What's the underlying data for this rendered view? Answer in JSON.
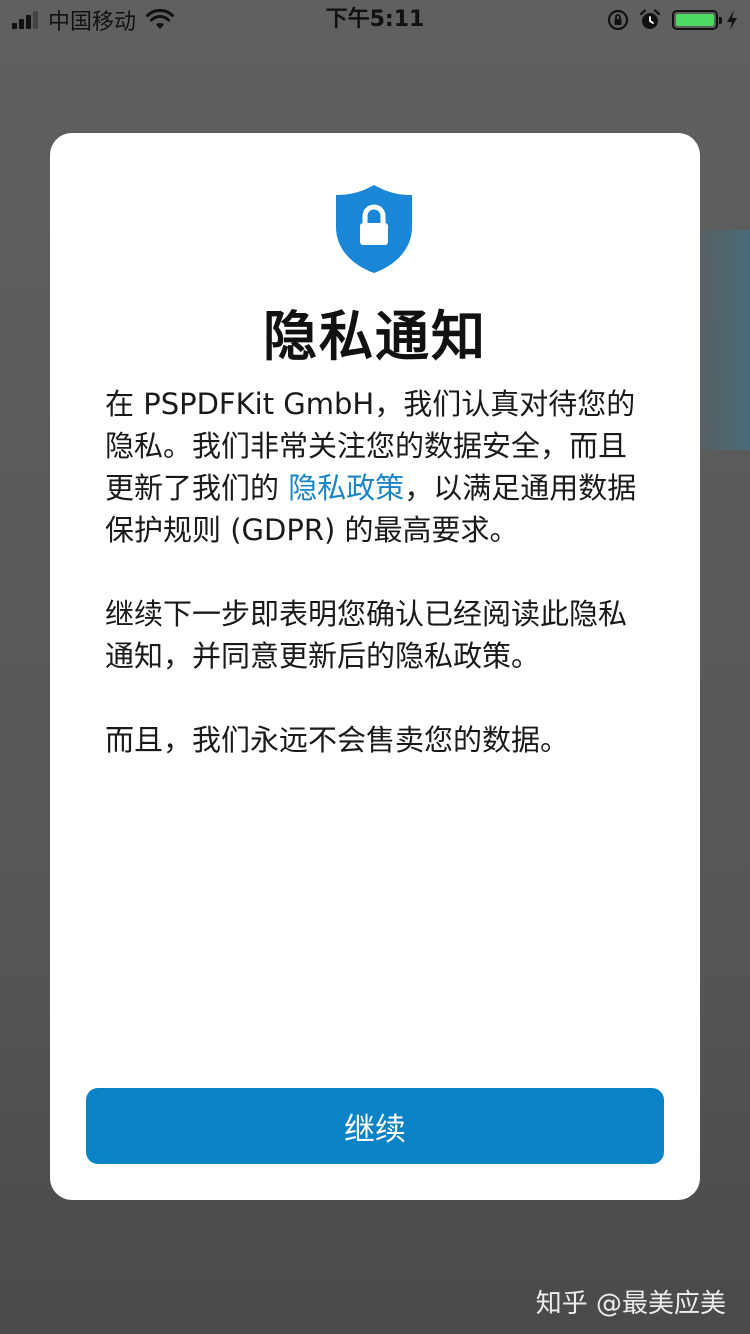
{
  "status_bar": {
    "carrier": "中国移动",
    "time": "下午5:11",
    "icons": [
      "signal-icon",
      "wifi-icon",
      "orientation-lock-icon",
      "alarm-icon",
      "battery-icon",
      "charging-icon"
    ],
    "battery_color": "#4cd964"
  },
  "modal": {
    "icon": "shield-lock-icon",
    "icon_color": "#1a86d8",
    "title": "隐私通知",
    "paragraph1": {
      "before_link": "在 PSPDFKit GmbH，我们认真对待您的隐私。我们非常关注您的数据安全，而且更新了我们的 ",
      "link_text": "隐私政策",
      "after_link": "，以满足通用数据保护规则 (GDPR) 的最高要求。"
    },
    "paragraph2": "继续下一步即表明您确认已经阅读此隐私通知，并同意更新后的隐私政策。",
    "paragraph3": "而且，我们永远不会售卖您的数据。",
    "continue_label": "继续",
    "accent_color": "#0a83c6",
    "link_color": "#1a86c8"
  },
  "watermark": {
    "text": "知乎 @最美应美"
  }
}
